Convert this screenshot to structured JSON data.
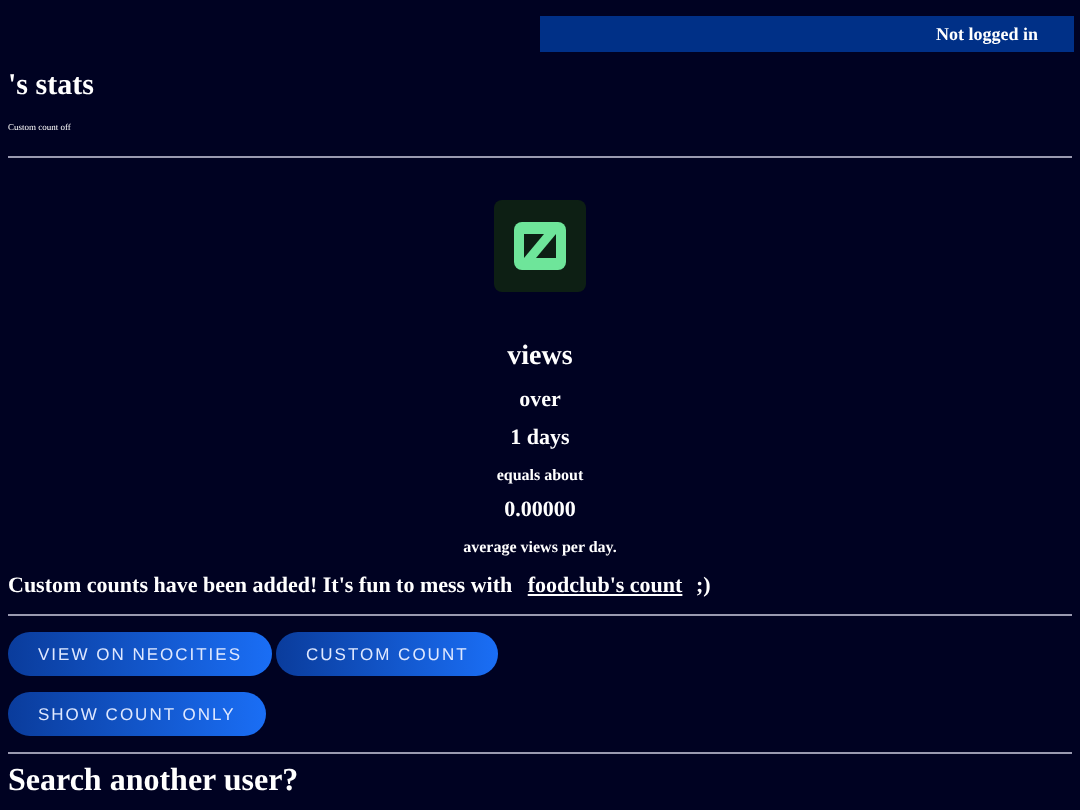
{
  "banner": {
    "text": "Not logged in"
  },
  "title": "'s stats",
  "note": "Custom count off",
  "stats": [
    {
      "text": "views",
      "kind": "large"
    },
    {
      "text": "over",
      "kind": "medium"
    },
    {
      "text": "1 days",
      "kind": "medium"
    },
    {
      "text": "equals about",
      "kind": "small"
    },
    {
      "text": "0.00000",
      "kind": "medium"
    },
    {
      "text": "average views per day.",
      "kind": "small"
    }
  ],
  "message": {
    "before": "Custom counts have been added! It's fun to mess with",
    "link": "foodclub's count",
    "after": ";)"
  },
  "buttons": [
    [
      "VIEW ON NEOCITIES",
      "CUSTOM COUNT"
    ],
    [
      "SHOW COUNT ONLY"
    ]
  ],
  "search_heading": "Search another user?"
}
